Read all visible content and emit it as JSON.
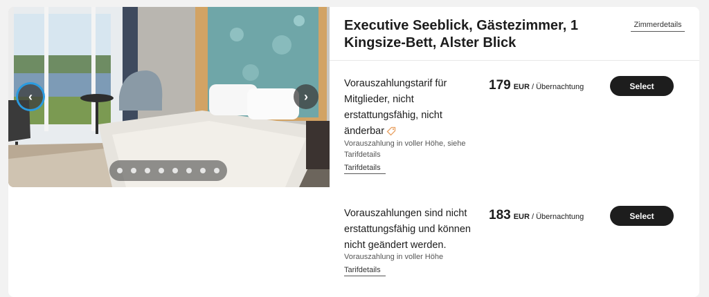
{
  "room": {
    "title": "Executive Seeblick, Gästezimmer, 1 Kingsize-Bett, Alster Blick",
    "details_link": "Zimmerdetails"
  },
  "gallery": {
    "prev_icon": "chevron-left-icon",
    "next_icon": "chevron-right-icon",
    "image_count": 8,
    "active_index": 0,
    "prev_glyph": "‹",
    "next_glyph": "›"
  },
  "rates": [
    {
      "name": "Vorauszahlungstarif für Mitglieder, nicht erstattungsfähig, nicht änderbar",
      "icon": "tag-icon",
      "note": "Vorauszahlung in voller Höhe, siehe Tarifdetails",
      "link": "Tarifdetails",
      "price": "179",
      "currency": "EUR",
      "per": "/ Übernachtung",
      "button": "Select"
    },
    {
      "name": "Vorauszahlungen sind nicht erstattungsfähig und können nicht geändert werden.",
      "note": "Vorauszahlung in voller Höhe",
      "link": "Tarifdetails",
      "price": "183",
      "currency": "EUR",
      "per": "/ Übernachtung",
      "button": "Select"
    }
  ],
  "colors": {
    "button_bg": "#1d1d1d",
    "accent_focus": "#2a9be0",
    "tag_icon": "#e8a060"
  }
}
